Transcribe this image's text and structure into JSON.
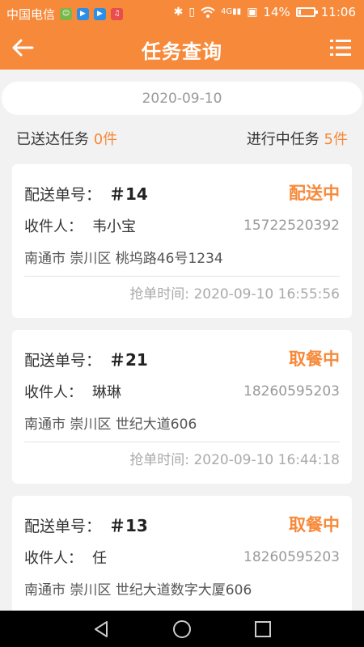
{
  "status_bar": {
    "carrier": "中国电信",
    "signal_4g": "4G",
    "battery_percent": 14,
    "battery_text": "14%",
    "time": "11:06"
  },
  "app_bar": {
    "title": "任务查询"
  },
  "filter": {
    "date": "2020-09-10"
  },
  "summary": {
    "delivered_label": "已送达任务",
    "delivered_count": "0件",
    "in_progress_label": "进行中任务",
    "in_progress_count": "5件"
  },
  "orders": [
    {
      "label": "配送单号：",
      "number": "＃14",
      "status": "配送中",
      "recipient_label": "收件人：",
      "recipient": "韦小宝",
      "phone": "15722520392",
      "address": "南通市 崇川区 桃坞路46号1234",
      "grab_time": "抢单时间: 2020-09-10 16:55:56"
    },
    {
      "label": "配送单号：",
      "number": "＃21",
      "status": "取餐中",
      "recipient_label": "收件人：",
      "recipient": "琳琳",
      "phone": "18260595203",
      "address": "南通市 崇川区 世纪大道606",
      "grab_time": "抢单时间: 2020-09-10 16:44:18"
    },
    {
      "label": "配送单号：",
      "number": "＃13",
      "status": "取餐中",
      "recipient_label": "收件人：",
      "recipient": "任",
      "phone": "18260595203",
      "address": "南通市 崇川区 世纪大道数字大厦606"
    }
  ],
  "icons": {
    "back": "back-arrow-icon",
    "menu": "list-menu-icon",
    "nav_back": "triangle-back-icon",
    "nav_home": "circle-home-icon",
    "nav_recent": "square-recent-icon"
  },
  "colors": {
    "accent": "#f7893a",
    "background": "#f2f2f2",
    "card": "#ffffff"
  }
}
